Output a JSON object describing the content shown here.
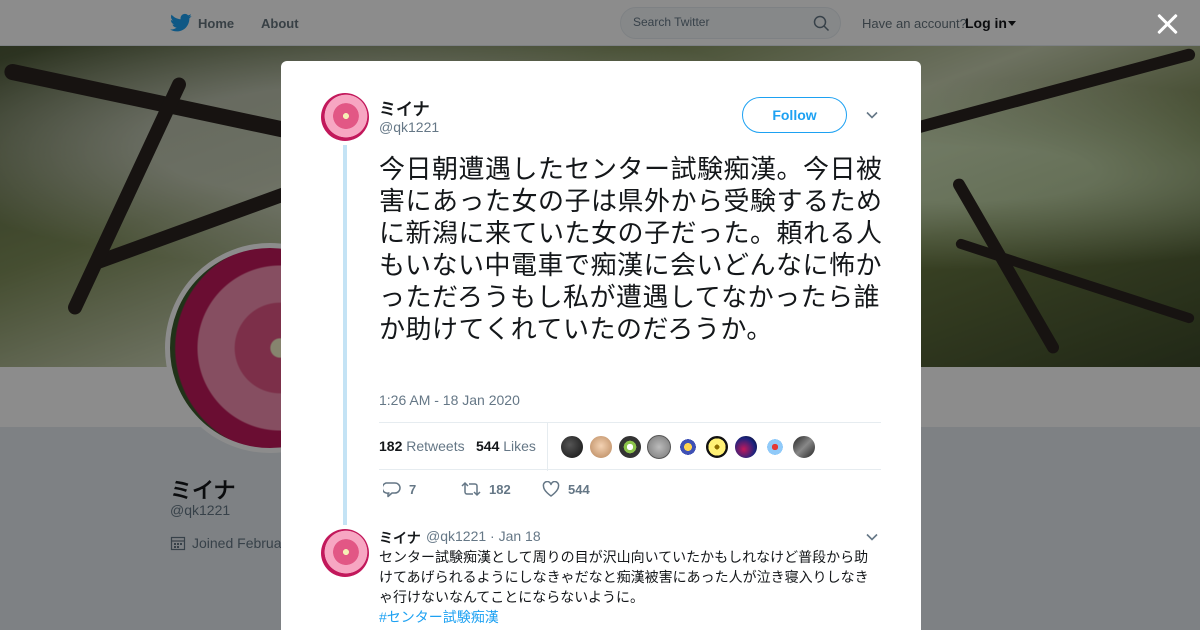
{
  "nav": {
    "home_label": "Home",
    "about_label": "About",
    "search_placeholder": "Search Twitter",
    "account_prompt": "Have an account?",
    "login_label": "Log in"
  },
  "profile": {
    "name": "ミイナ",
    "handle": "@qk1221",
    "joined": "Joined Februa"
  },
  "tweet": {
    "author_name": "ミイナ",
    "author_handle": "@qk1221",
    "follow_label": "Follow",
    "text": "今日朝遭遇したセンター試験痴漢。今日被害にあった女の子は県外から受験するために新潟に来ていた女の子だった。頼れる人もいない中電車で痴漢に会いどんなに怖かっただろうもし私が遭遇してなかったら誰か助けてくれていたのだろうか。",
    "timestamp": "1:26 AM - 18 Jan 2020",
    "retweets_count": "182",
    "retweets_label": "Retweets",
    "likes_count": "544",
    "likes_label": "Likes",
    "actions": {
      "reply_count": "7",
      "retweet_count": "182",
      "like_count": "544"
    }
  },
  "reply": {
    "author_name": "ミイナ",
    "meta": "@qk1221 · Jan 18",
    "text": "センター試験痴漢として周りの目が沢山向いていたかもしれなけど普段から助けてあげられるようにしなきゃだなと痴漢被害にあった人が泣き寝入りしなきゃ行けないなんてことにならないように。",
    "hashtag": "#センター試験痴漢"
  },
  "colors": {
    "accent": "#1da1f2",
    "text_primary": "#14171a",
    "text_secondary": "#657786"
  },
  "icons": [
    "twitter-bird-icon",
    "search-icon",
    "caret-down-icon",
    "close-icon",
    "chevron-down-icon",
    "reply-icon",
    "retweet-icon",
    "heart-icon",
    "calendar-icon"
  ]
}
